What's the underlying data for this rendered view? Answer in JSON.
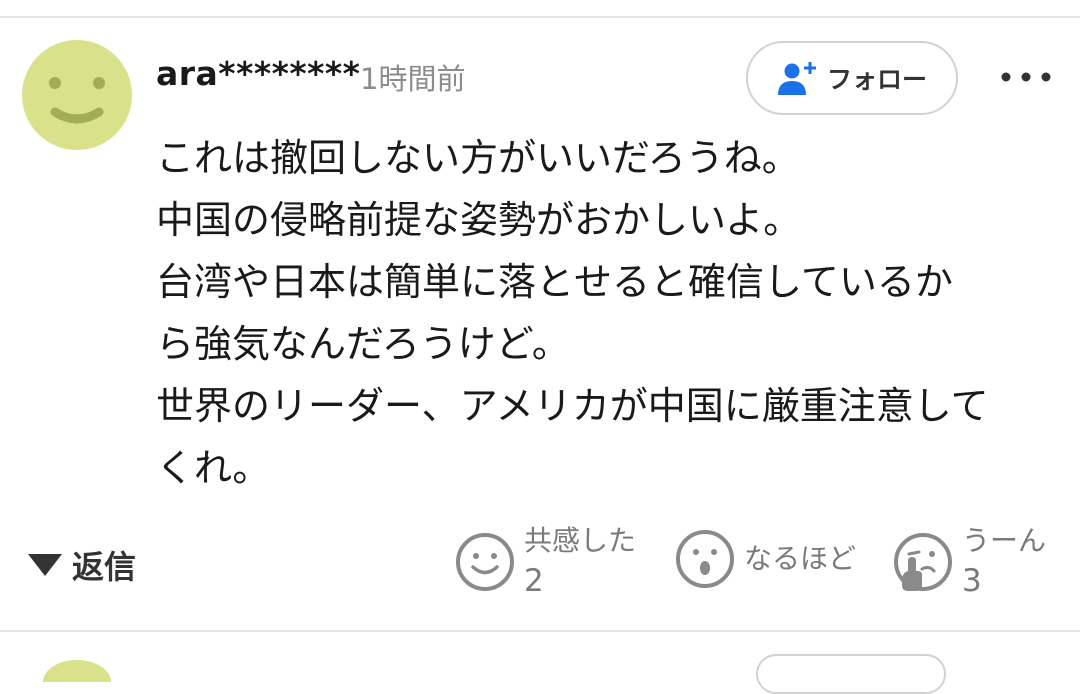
{
  "comment": {
    "username": "ara********",
    "timestamp": "1時間前",
    "follow_label": "フォロー",
    "body_lines": [
      "これは撤回しない方がいいだろうね。",
      "中国の侵略前提な姿勢がおかしいよ。",
      "台湾や日本は簡単に落とせると確信しているか",
      "ら強気なんだろうけど。",
      "世界のリーダー、アメリカが中国に厳重注意して",
      "くれ。"
    ]
  },
  "actions": {
    "reply_label": "返信",
    "reactions": [
      {
        "name": "共感した",
        "count": "2",
        "icon": "smile-face-icon"
      },
      {
        "name": "なるほど",
        "count": "",
        "icon": "surprised-face-icon"
      },
      {
        "name": "うーん",
        "count": "3",
        "icon": "thinking-face-icon"
      }
    ]
  },
  "colors": {
    "avatar": "#d9e28a",
    "follow_icon": "#1b72e8",
    "muted_text": "#8c8c8c",
    "reaction_text": "#7a7a7a"
  }
}
